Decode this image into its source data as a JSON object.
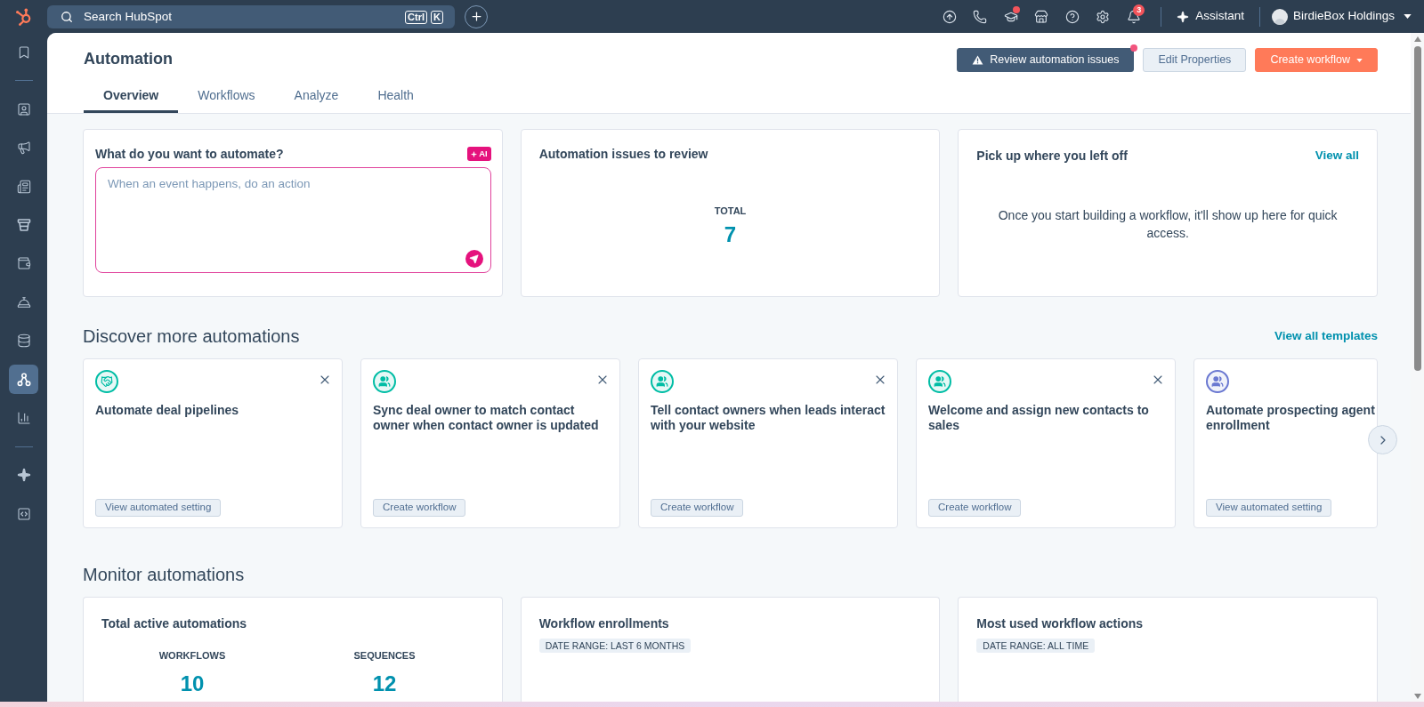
{
  "top_bar": {
    "search": {
      "placeholder": "Search HubSpot",
      "keys": [
        "Ctrl",
        "K"
      ]
    },
    "utility_icons": [
      {
        "kind": "upload",
        "dot": false
      },
      {
        "kind": "phone",
        "dot": false
      },
      {
        "kind": "academy",
        "dot": true
      },
      {
        "kind": "marketplace",
        "dot": false
      },
      {
        "kind": "help",
        "dot": false
      },
      {
        "kind": "settings",
        "dot": false
      },
      {
        "kind": "notifications",
        "dot": false,
        "badge": "3"
      }
    ],
    "assistant": "Assistant",
    "account": "BirdieBox Holdings"
  },
  "sidebar": {
    "items": [
      {
        "kind": "bookmarks",
        "selected": false
      },
      {
        "kind": "divider"
      },
      {
        "kind": "contacts",
        "selected": false
      },
      {
        "kind": "marketing",
        "selected": false
      },
      {
        "kind": "content",
        "selected": false
      },
      {
        "kind": "commerce",
        "selected": false
      },
      {
        "kind": "sales",
        "selected": false
      },
      {
        "kind": "service",
        "selected": false
      },
      {
        "kind": "data",
        "selected": false
      },
      {
        "kind": "automation",
        "selected": true
      },
      {
        "kind": "reporting",
        "selected": false
      },
      {
        "kind": "divider"
      },
      {
        "kind": "breeze",
        "selected": false
      },
      {
        "kind": "development",
        "selected": false
      }
    ]
  },
  "header": {
    "title": "Automation",
    "buttons": [
      {
        "kind": "warning",
        "label": "Review automation issues",
        "dot": true
      },
      {
        "kind": "secondary",
        "label": "Edit Properties",
        "dropdown": false
      },
      {
        "kind": "primary",
        "label": "Create workflow",
        "dropdown": true
      }
    ],
    "tabs": [
      {
        "label": "Overview",
        "selected": true
      },
      {
        "label": "Workflows",
        "selected": false
      },
      {
        "label": "Analyze",
        "selected": false
      },
      {
        "label": "Health",
        "selected": false
      }
    ]
  },
  "overview_cards": {
    "prompt": {
      "title": "What do you want to automate?",
      "badge": "AI",
      "placeholder": "When an event happens, do an action"
    },
    "issues": {
      "title": "Automation issues to review",
      "total_label": "TOTAL",
      "total": "7"
    },
    "recent": {
      "title": "Pick up where you left off",
      "link": "View all",
      "empty_text": "Once you start building a workflow, it'll show up here for quick access."
    }
  },
  "discover": {
    "title": "Discover more automations",
    "link": "View all templates",
    "templates": [
      {
        "kind": "deals",
        "color": "#00bda5",
        "title": "Automate deal pipelines",
        "button": "View automated setting",
        "dismissible": true
      },
      {
        "kind": "contacts",
        "color": "#00bda5",
        "title": "Sync deal owner to match contact owner when contact owner is updated",
        "button": "Create workflow",
        "dismissible": true
      },
      {
        "kind": "contacts",
        "color": "#00bda5",
        "title": "Tell contact owners when leads interact with your website",
        "button": "Create workflow",
        "dismissible": true
      },
      {
        "kind": "contacts",
        "color": "#00bda5",
        "title": "Welcome and assign new contacts to sales",
        "button": "Create workflow",
        "dismissible": true
      },
      {
        "kind": "contacts",
        "color": "#6a78d1",
        "title": "Automate prospecting agent enrollment",
        "button": "View automated setting",
        "dismissible": false
      }
    ]
  },
  "monitor": {
    "title": "Monitor automations",
    "cards": [
      {
        "kind": "stats",
        "title": "Total active automations",
        "stats": [
          {
            "label": "WORKFLOWS",
            "value": "10"
          },
          {
            "label": "SEQUENCES",
            "value": "12"
          }
        ]
      },
      {
        "kind": "date_range",
        "title": "Workflow enrollments",
        "badge": "DATE RANGE: LAST 6 MONTHS"
      },
      {
        "kind": "date_range",
        "title": "Most used workflow actions",
        "badge": "DATE RANGE: ALL TIME"
      }
    ]
  }
}
